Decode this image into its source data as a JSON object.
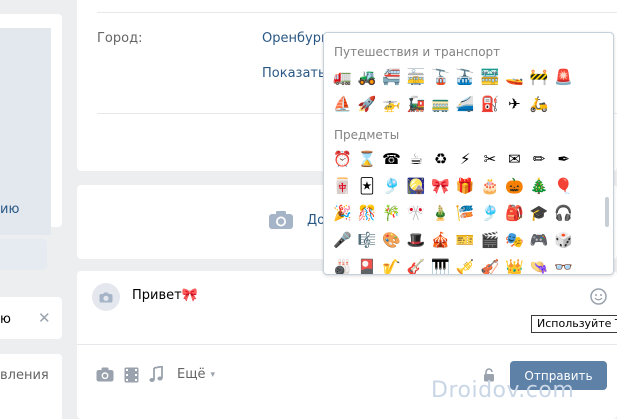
{
  "profile": {
    "city_label": "Город:",
    "city_value": "Оренбург",
    "show_label": "Показать"
  },
  "left": {
    "partial_link": "ию",
    "partial_input": "ю",
    "partial_text": "вления"
  },
  "upload": {
    "partial_label": "До"
  },
  "emoji_panel": {
    "section_travel": "Путешествия и транспорт",
    "section_objects": "Предметы",
    "travel": [
      "🚛",
      "🚜",
      "🚝",
      "🚋",
      "🚡",
      "🚠",
      "🚟",
      "🚤",
      "🚧",
      "🚨",
      "⛵",
      "🚀",
      "🚁",
      "🚂",
      "🚃",
      "🚄",
      "⛽",
      "✈",
      "🛵"
    ],
    "objects": [
      "⏰",
      "⌛",
      "☎",
      "☕",
      "♻",
      "⚡",
      "✂",
      "✉",
      "✏",
      "✒",
      "🀄",
      "🃏",
      "🎐",
      "🎑",
      "🎀",
      "🎁",
      "🎂",
      "🎃",
      "🎄",
      "🎈",
      "🎉",
      "🎊",
      "🎋",
      "🎌",
      "🎍",
      "🎏",
      "🎐",
      "🎒",
      "🎓",
      "🎧",
      "🎤",
      "🎼",
      "🎨",
      "🎩",
      "🎪",
      "🎫",
      "🎬",
      "🎭",
      "🎮",
      "🎲",
      "🎳",
      "🎴",
      "🎷",
      "🎸",
      "🎹",
      "🎺",
      "🎻",
      "👑",
      "👒",
      "👓"
    ]
  },
  "composer": {
    "message_text": "Привет🎀",
    "tooltip": "Используйте T",
    "more_label": "Ещё",
    "send_label": "Отправить"
  },
  "watermark": "Droidov.com",
  "colors": {
    "background": "#edeef0",
    "link": "#2a5885",
    "button": "#5e81a8",
    "icon": "#99a2ad"
  }
}
